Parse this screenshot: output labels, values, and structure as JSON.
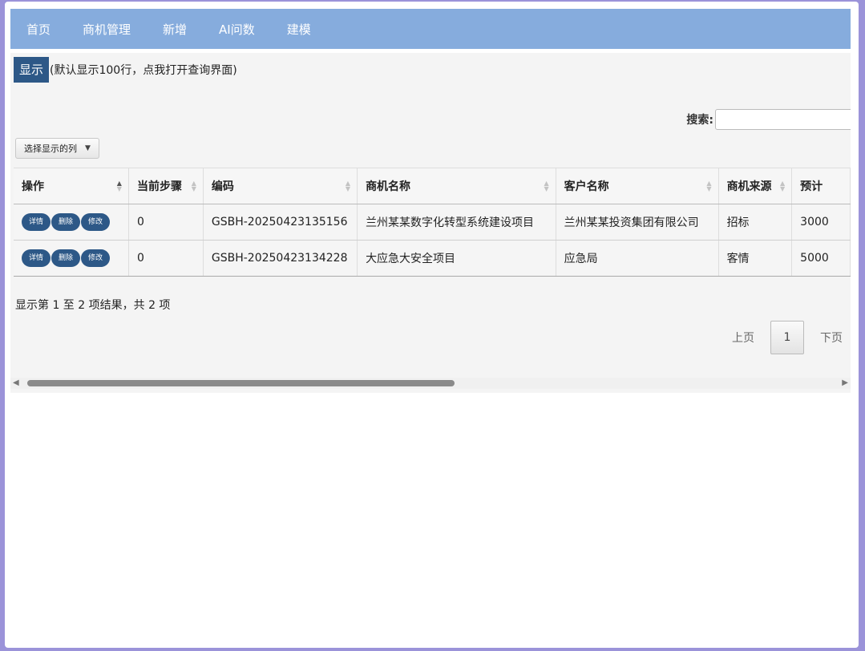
{
  "nav": [
    "首页",
    "商机管理",
    "新增",
    "AI问数",
    "建模"
  ],
  "toolbar": {
    "show_label": "显示",
    "show_hint": "(默认显示100行，点我打开查询界面)",
    "search_label": "搜索:",
    "search_value": "",
    "column_select_label": "选择显示的列"
  },
  "table": {
    "headers": [
      "操作",
      "当前步骤",
      "编码",
      "商机名称",
      "客户名称",
      "商机来源",
      "预计"
    ],
    "action_labels": [
      "详情",
      "删除",
      "修改"
    ],
    "rows": [
      [
        "0",
        "GSBH-20250423135156",
        "兰州某某数字化转型系统建设项目",
        "兰州某某投资集团有限公司",
        "招标",
        "3000"
      ],
      [
        "0",
        "GSBH-20250423134228",
        "大应急大安全项目",
        "应急局",
        "客情",
        "5000"
      ]
    ]
  },
  "footer": {
    "info": "显示第 1 至 2 项结果，共 2 项",
    "prev": "上页",
    "page": "1",
    "next": "下页"
  },
  "colors": {
    "nav_bg": "#86acdd",
    "button_bg": "#2d5887",
    "outer_bg": "#9b93d9"
  }
}
